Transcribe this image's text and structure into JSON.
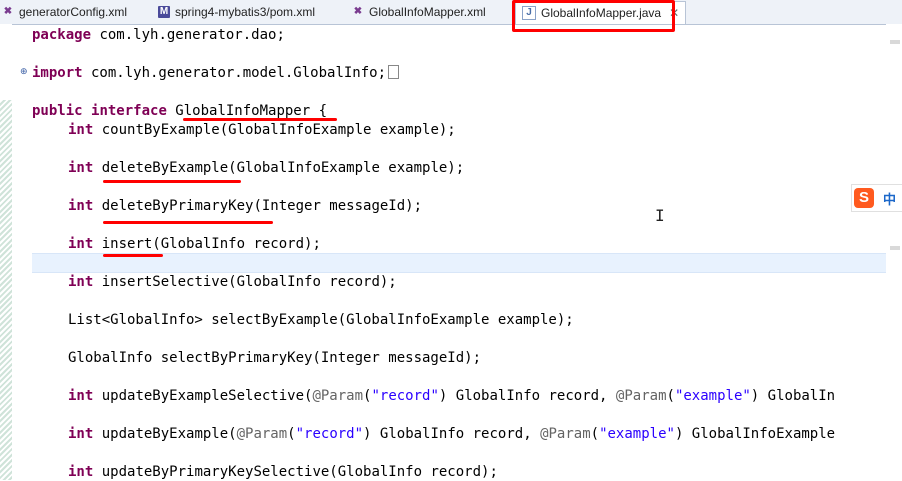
{
  "tabs": [
    {
      "label": "generatorConfig.xml",
      "icon": "xml-file-icon"
    },
    {
      "label": "spring4-mybatis3/pom.xml",
      "icon": "maven-pom-icon"
    },
    {
      "label": "GlobalInfoMapper.xml",
      "icon": "xml-file-icon"
    },
    {
      "label": "GlobalInfoMapper.java",
      "icon": "java-file-icon",
      "active": true,
      "close": "✕"
    }
  ],
  "icons": {
    "xml": "✖",
    "maven": "M",
    "java": "J"
  },
  "code": {
    "l1": {
      "kw": "package",
      "rest": " com.lyh.generator.dao;"
    },
    "l2": {
      "kw": "import",
      "rest": " com.lyh.generator.model.GlobalInfo;"
    },
    "l3": {
      "kw1": "public",
      "kw2": "interface",
      "rest": " GlobalInfoMapper {"
    },
    "l4": {
      "kw": "int",
      "rest": " countByExample(GlobalInfoExample example);"
    },
    "l5": {
      "kw": "int",
      "rest": " deleteByExample(GlobalInfoExample example);"
    },
    "l6": {
      "kw": "int",
      "rest": " deleteByPrimaryKey(Integer messageId);"
    },
    "l7": {
      "kw": "int",
      "rest": " insert(GlobalInfo record);"
    },
    "l8": {
      "kw": "int",
      "rest": " insertSelective(GlobalInfo record);"
    },
    "l9": {
      "rest": "List<GlobalInfo> selectByExample(GlobalInfoExample example);"
    },
    "l10": {
      "rest": "GlobalInfo selectByPrimaryKey(Integer messageId);"
    },
    "l11": {
      "kw": "int",
      "a": " updateByExampleSelective(",
      "ann1": "@Param",
      "b": "(",
      "s1": "\"record\"",
      "c": ") GlobalInfo record, ",
      "ann2": "@Param",
      "d": "(",
      "s2": "\"example\"",
      "e": ") GlobalIn"
    },
    "l12": {
      "kw": "int",
      "a": " updateByExample(",
      "ann1": "@Param",
      "b": "(",
      "s1": "\"record\"",
      "c": ") GlobalInfo record, ",
      "ann2": "@Param",
      "d": "(",
      "s2": "\"example\"",
      "e": ") GlobalInfoExample"
    },
    "l13": {
      "kw": "int",
      "rest": " updateByPrimaryKeySelective(GlobalInfo record);"
    }
  },
  "ime": {
    "logo": "S",
    "lang": "中"
  },
  "colors": {
    "keyword": "#7f0055",
    "string": "#2a00ff",
    "annotation": "#646464",
    "highlight": "#ff0000"
  }
}
